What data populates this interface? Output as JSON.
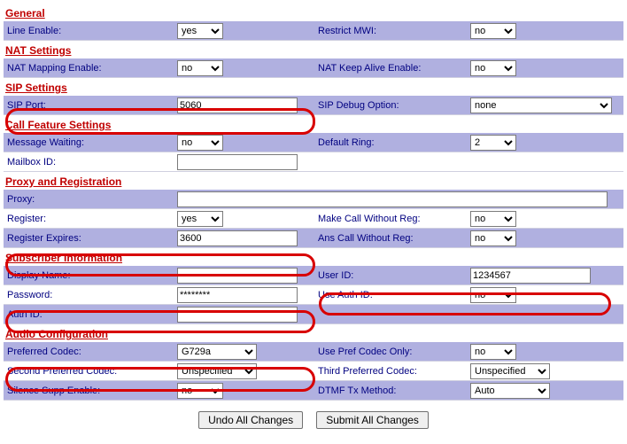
{
  "sections": {
    "general": {
      "title": "General",
      "line_enable_label": "Line Enable:",
      "line_enable_value": "yes",
      "restrict_mwi_label": "Restrict MWI:",
      "restrict_mwi_value": "no"
    },
    "nat": {
      "title": "NAT Settings",
      "mapping_label": "NAT Mapping Enable:",
      "mapping_value": "no",
      "keepalive_label": "NAT Keep Alive Enable:",
      "keepalive_value": "no"
    },
    "sip": {
      "title": "SIP Settings",
      "port_label": "SIP Port:",
      "port_value": "5060",
      "debug_label": "SIP Debug Option:",
      "debug_value": "none"
    },
    "callfeat": {
      "title": "Call Feature Settings",
      "msgwait_label": "Message Waiting:",
      "msgwait_value": "no",
      "defring_label": "Default Ring:",
      "defring_value": "2",
      "mailbox_label": "Mailbox ID:",
      "mailbox_value": ""
    },
    "proxy": {
      "title": "Proxy and Registration",
      "proxy_label": "Proxy:",
      "proxy_value": "",
      "register_label": "Register:",
      "register_value": "yes",
      "makecall_label": "Make Call Without Reg:",
      "makecall_value": "no",
      "regexp_label": "Register Expires:",
      "regexp_value": "3600",
      "anscall_label": "Ans Call Without Reg:",
      "anscall_value": "no"
    },
    "sub": {
      "title": "Subscriber Information",
      "dispname_label": "Display Name:",
      "dispname_value": "",
      "userid_label": "User ID:",
      "userid_value": "1234567",
      "password_label": "Password:",
      "password_value": "********",
      "useauth_label": "Use Auth ID:",
      "useauth_value": "no",
      "authid_label": "Auth ID:",
      "authid_value": ""
    },
    "audio": {
      "title": "Audio Configuration",
      "pref_label": "Preferred Codec:",
      "pref_value": "G729a",
      "useprefonly_label": "Use Pref Codec Only:",
      "useprefonly_value": "no",
      "second_label": "Second Preferred Codec:",
      "second_value": "Unspecified",
      "third_label": "Third Preferred Codec:",
      "third_value": "Unspecified",
      "silence_label": "Silence Supp Enable:",
      "silence_value": "no",
      "dtmf_label": "DTMF Tx Method:",
      "dtmf_value": "Auto"
    }
  },
  "buttons": {
    "undo": "Undo All Changes",
    "submit": "Submit All Changes"
  }
}
